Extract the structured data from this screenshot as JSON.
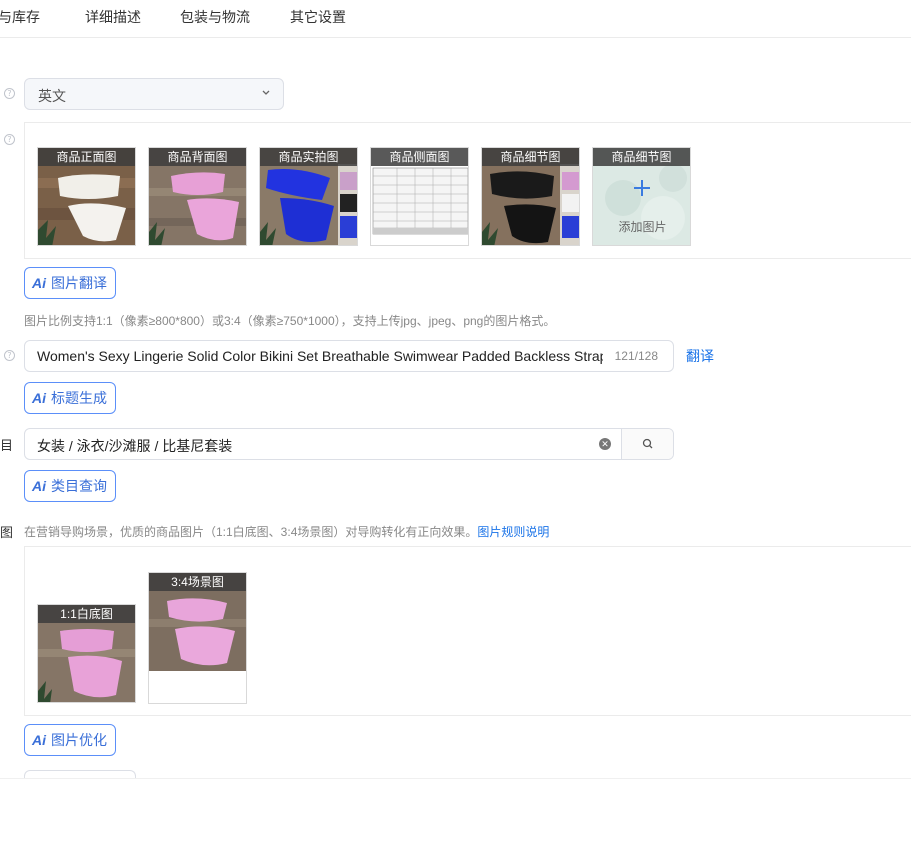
{
  "tabs": [
    "与库存",
    "详细描述",
    "包装与物流",
    "其它设置"
  ],
  "language_select": {
    "value": "英文"
  },
  "product_images": [
    {
      "caption": "商品正面图"
    },
    {
      "caption": "商品背面图"
    },
    {
      "caption": "商品实拍图"
    },
    {
      "caption": "商品侧面图"
    },
    {
      "caption": "商品细节图"
    },
    {
      "caption": "商品细节图",
      "overlay_label": "添加图片"
    }
  ],
  "buttons": {
    "image_translate": "图片翻译",
    "title_generate": "标题生成",
    "category_query": "类目查询",
    "image_optimize": "图片优化",
    "ai_label": "Ai"
  },
  "image_hint": "图片比例支持1:1（像素≥800*800）或3:4（像素≥750*1000），支持上传jpg、jpeg、png的图片格式。",
  "title": {
    "value": "Women's Sexy Lingerie Solid Color Bikini Set Breathable Swimwear Padded Backless Straps Bikini",
    "count": "121/128",
    "translate_link": "翻译"
  },
  "category": {
    "side_label": "目",
    "value": "女装 / 泳衣/沙滩服 / 比基尼套装"
  },
  "marketing": {
    "side_label": "图",
    "hint": "在营销导购场景，优质的商品图片（1:1白底图、3:4场景图）对导购转化有正向效果。",
    "link": "图片规则说明",
    "images": [
      {
        "caption": "1:1白底图"
      },
      {
        "caption": "3:4场景图"
      }
    ]
  },
  "colors": {
    "accent": "#1a73e8",
    "ai_button_border": "#5b8ff9",
    "caption_bg": "#3c3c3c"
  },
  "icons": [
    "help-icon",
    "chevron-down-icon",
    "plus-icon",
    "clear-icon",
    "search-icon"
  ]
}
